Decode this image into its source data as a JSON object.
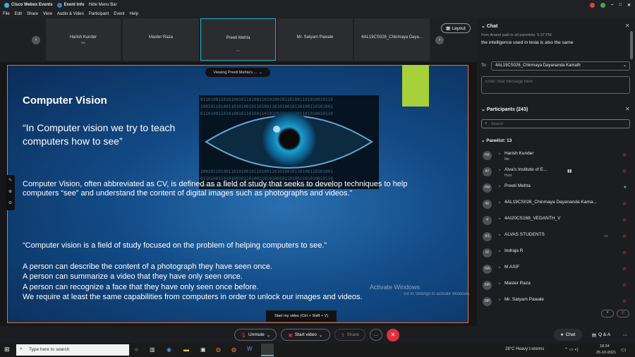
{
  "titlebar": {
    "app": "Cisco Webex Events",
    "event_info": "Event Info",
    "hide_menu": "Hide Menu Bar"
  },
  "menubar": {
    "items": [
      "File",
      "Edit",
      "Share",
      "View",
      "Audio & Video",
      "Participant",
      "Event",
      "Help"
    ]
  },
  "video_tiles": [
    {
      "name": "Harish Kunder",
      "sub": "Me"
    },
    {
      "name": "Master Raza",
      "sub": ""
    },
    {
      "name": "Preeti Mehta",
      "sub": ""
    },
    {
      "name": "Mr. Satyam Pawale",
      "sub": ""
    },
    {
      "name": "4AL19CS026_Chinmaya Daya...",
      "sub": ""
    }
  ],
  "layout_label": "Layout",
  "viewing_label": "Viewing Preeti Mehta's ...",
  "slide": {
    "title": "Computer Vision",
    "quote": "“In Computer vision we try to teach computers how to see”",
    "para1": "Computer Vision, often abbreviated as CV, is defined as a field of study that seeks to develop techniques to help computers “see” and understand the content of digital images such as photographs and videos.”",
    "para2": "“Computer vision is a field of study focused on the problem of helping computers to see.”",
    "line1": "A person can describe the content of a photograph they have seen once.",
    "line2": "A person can summarize a video that they have only seen once.",
    "line3": "A person can recognize a face that they have only seen once before.",
    "line4": "We require at least the same capabilities from computers in order to unlock our images and videos."
  },
  "watermark": {
    "title": "Activate Windows",
    "sub": "Go to Settings to activate Windows."
  },
  "tooltip": "Start my video (Ctrl + Shift + V)",
  "controls": {
    "unmute": "Unmute",
    "start_video": "Start video",
    "share": "Share",
    "chat": "Chat",
    "qa": "Q & A"
  },
  "chat": {
    "header": "Chat",
    "from_line": "from Anand patil to all panelists:   5:37 PM",
    "message": "the intelligence used in tesla is also the same",
    "to_label": "To:",
    "to_value": "4AL19CS026_Chinmaya Dayananda Kamath",
    "placeholder": "Enter chat message here"
  },
  "participants": {
    "header": "Participants (243)",
    "search_placeholder": "Search",
    "panelist_label": "Panelist: 13",
    "list": [
      {
        "initials": "HK",
        "name": "Harish Kunder",
        "sub": "Me",
        "mic": "muted"
      },
      {
        "initials": "AT",
        "name": "Alva's Institute of E...",
        "sub": "Host",
        "mic": "muted"
      },
      {
        "initials": "PM",
        "name": "Preeti Mehta",
        "sub": "",
        "mic": "active"
      },
      {
        "initials": "4K",
        "name": "4AL19CS026_Chinmaya Dayananda Kama...",
        "sub": "",
        "mic": "muted"
      },
      {
        "initials": "4",
        "name": "4AI20CS168_VEDANTH_V",
        "sub": "",
        "mic": "muted"
      },
      {
        "initials": "AS",
        "name": "ALVAS STUDENTS",
        "sub": "",
        "mic": "muted"
      },
      {
        "initials": "IR",
        "name": "Indraja R",
        "sub": "",
        "mic": "muted"
      },
      {
        "initials": "MA",
        "name": "M ASIF",
        "sub": "",
        "mic": "muted"
      },
      {
        "initials": "MR",
        "name": "Master Raza",
        "sub": "",
        "mic": "muted"
      },
      {
        "initials": "MP",
        "name": "Mr. Satyam Pawale",
        "sub": "",
        "mic": "muted"
      }
    ]
  },
  "taskbar": {
    "search": "Type here to search",
    "weather": "28°C  Heavy t-storms",
    "time": "18:34",
    "date": "25-10-2021"
  },
  "colors": {
    "accent": "#22b8cf",
    "end": "#e0313b",
    "muted": "#e0313b",
    "active_mic": "#39c46a",
    "slide_border": "#e8702a"
  }
}
